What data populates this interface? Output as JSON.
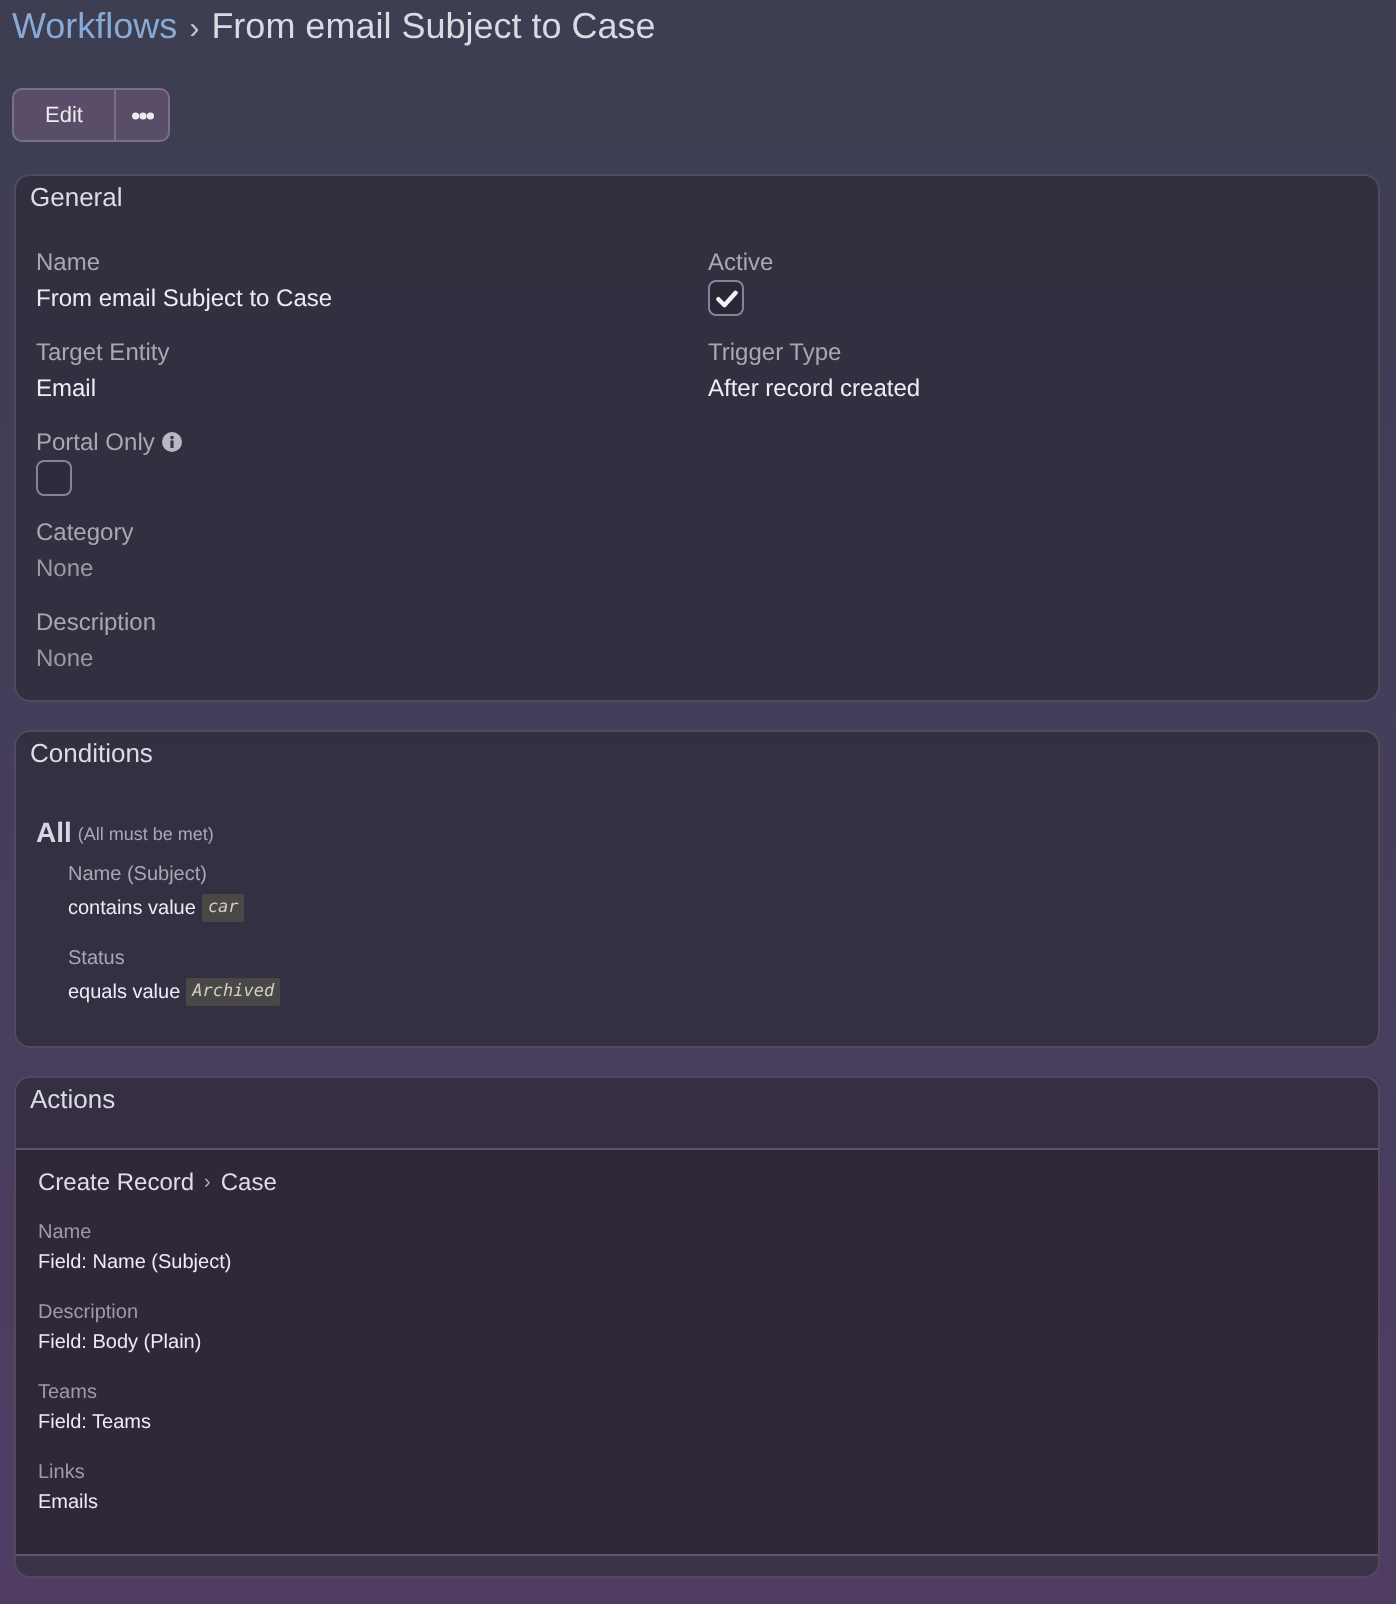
{
  "breadcrumb": {
    "link": "Workflows",
    "separator": "›",
    "title": "From email Subject to Case"
  },
  "toolbar": {
    "edit_button": "Edit"
  },
  "general": {
    "title": "General",
    "rows": [
      [
        {
          "kind": "text",
          "label": "Name",
          "value": "From email Subject to Case",
          "empty": false,
          "info": false
        },
        {
          "kind": "checkbox",
          "label": "Active",
          "checked": true,
          "info": false
        }
      ],
      [
        {
          "kind": "text",
          "label": "Target Entity",
          "value": "Email",
          "empty": false,
          "info": false
        },
        {
          "kind": "text",
          "label": "Trigger Type",
          "value": "After record created",
          "empty": false,
          "info": false
        }
      ],
      [
        {
          "kind": "checkbox",
          "label": "Portal Only",
          "checked": false,
          "info": true
        }
      ],
      [
        {
          "kind": "text",
          "label": "Category",
          "value": "None",
          "empty": true,
          "info": false
        }
      ],
      [
        {
          "kind": "text",
          "label": "Description",
          "value": "None",
          "empty": true,
          "info": false
        }
      ]
    ]
  },
  "conditions": {
    "title": "Conditions",
    "group": {
      "label": "All",
      "note": "(All must be met)",
      "items": [
        {
          "field": "Name (Subject)",
          "operator": "contains value",
          "value": "car"
        },
        {
          "field": "Status",
          "operator": "equals value",
          "value": "Archived"
        }
      ]
    }
  },
  "actions": {
    "title": "Actions",
    "items": [
      {
        "type": "Create Record",
        "separator": "›",
        "target": "Case",
        "fields": [
          {
            "label": "Name",
            "value": "Field: Name (Subject)"
          },
          {
            "label": "Description",
            "value": "Field: Body (Plain)"
          },
          {
            "label": "Teams",
            "value": "Field: Teams"
          },
          {
            "label": "Links",
            "value": "Emails"
          }
        ]
      }
    ]
  }
}
